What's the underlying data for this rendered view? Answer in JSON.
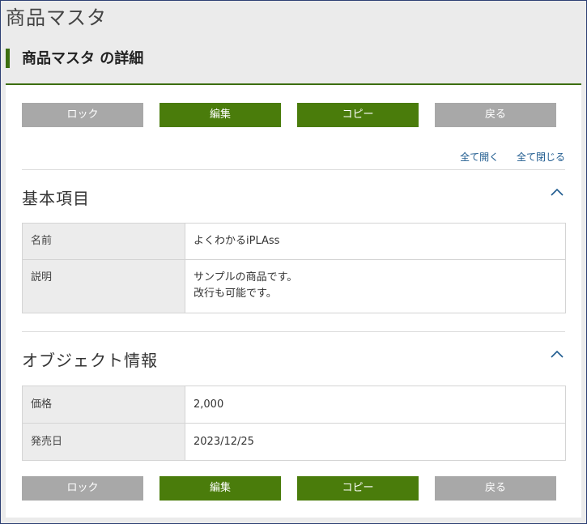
{
  "app": {
    "title": "商品マスタ"
  },
  "page": {
    "title": "商品マスタ の詳細"
  },
  "actions": {
    "lock": "ロック",
    "edit": "編集",
    "copy": "コピー",
    "back": "戻る"
  },
  "toggles": {
    "expand_all": "全て開く",
    "collapse_all": "全て閉じる"
  },
  "sections": [
    {
      "title": "基本項目",
      "rows": [
        {
          "label": "名前",
          "value": "よくわかるiPLAss"
        },
        {
          "label": "説明",
          "value": "サンプルの商品です。\n改行も可能です。"
        }
      ]
    },
    {
      "title": "オブジェクト情報",
      "rows": [
        {
          "label": "価格",
          "value": "2,000"
        },
        {
          "label": "発売日",
          "value": "2023/12/25"
        }
      ]
    }
  ],
  "colors": {
    "accent": "#4a7c0b",
    "button_gray": "#a8a8a8",
    "link": "#1f5b8f"
  },
  "icons": {
    "collapse": "chevron-up-icon"
  }
}
